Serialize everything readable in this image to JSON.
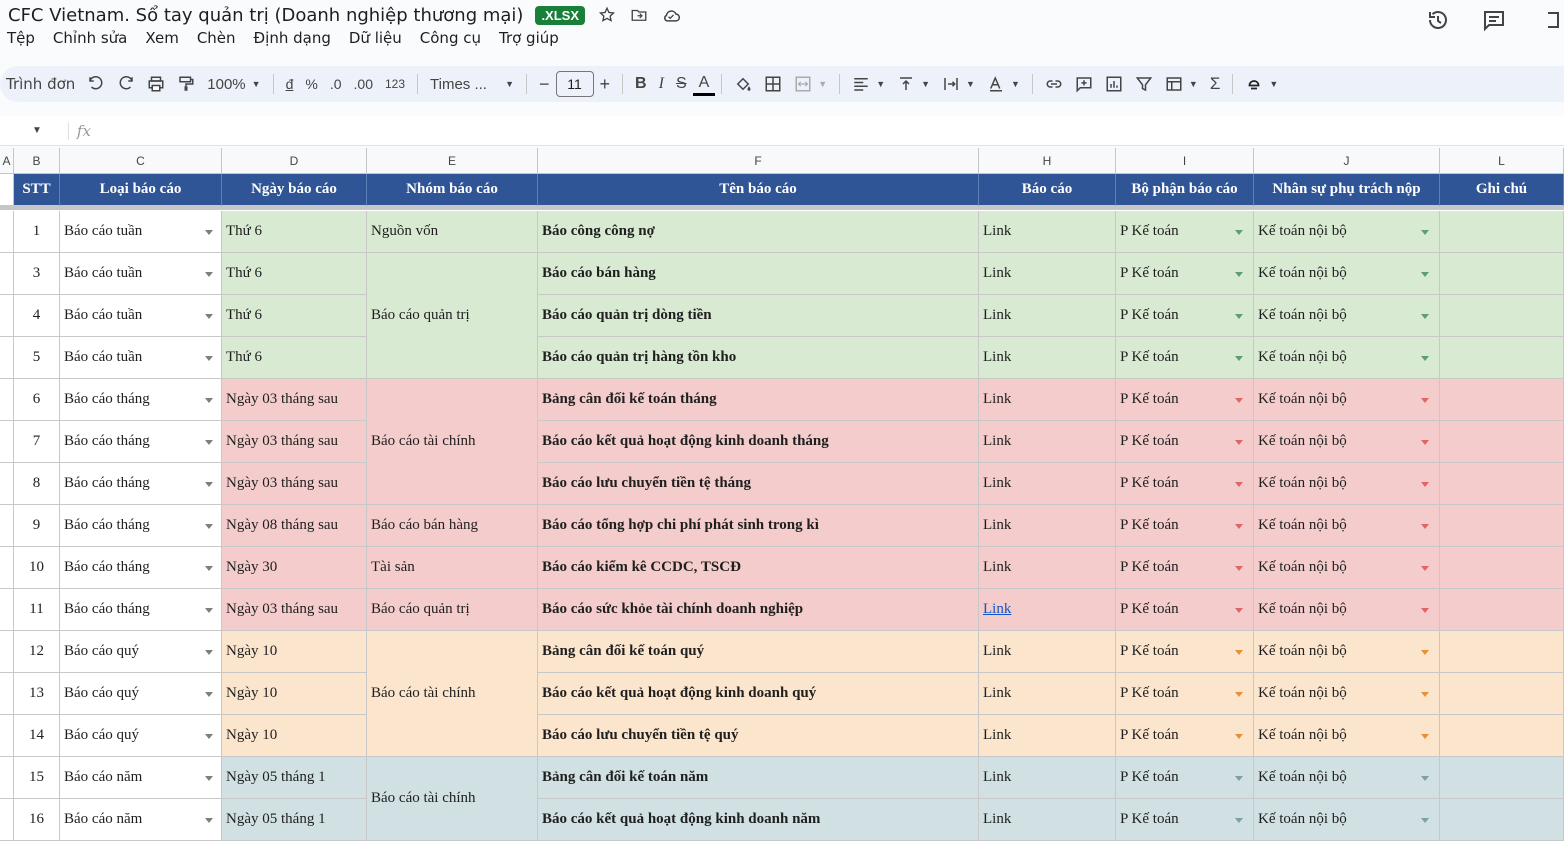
{
  "app": {
    "doc_title": "CFC Vietnam. Sổ tay quản trị (Doanh nghiệp thương mại)",
    "file_badge": ".XLSX"
  },
  "menu": [
    "Tệp",
    "Chỉnh sửa",
    "Xem",
    "Chèn",
    "Định dạng",
    "Dữ liệu",
    "Công cụ",
    "Trợ giúp"
  ],
  "toolbar": {
    "menus_label": "Trình đơn",
    "zoom": "100%",
    "currency": "đ",
    "percent": "%",
    "dec_decrease": ".0",
    "dec_increase": ".00",
    "number_format": "123",
    "font": "Times ...",
    "font_size": "11",
    "minus": "−",
    "plus": "+",
    "bold": "B",
    "italic": "I",
    "strike": "S",
    "text_color": "A",
    "sigma": "Σ"
  },
  "formula": {
    "fx": "fx"
  },
  "columns": [
    "A",
    "B",
    "C",
    "D",
    "E",
    "F",
    "H",
    "I",
    "J",
    "L"
  ],
  "headers": {
    "stt": "STT",
    "loai": "Loại báo cáo",
    "ngay": "Ngày báo cáo",
    "nhom": "Nhóm báo cáo",
    "ten": "Tên báo cáo",
    "baocao": "Báo cáo",
    "bophan": "Bộ phận báo cáo",
    "nhansu": "Nhân sự phụ trách nộp",
    "ghichu": "Ghi chú"
  },
  "rows": [
    {
      "stt": "1",
      "loai": "Báo cáo tuần",
      "ngay": "Thứ 6",
      "ten": "Báo công công nợ",
      "link": "Link",
      "bophan": "P Kế toán",
      "nhansu": "Kế toán nội bộ"
    },
    {
      "stt": "3",
      "loai": "Báo cáo tuần",
      "ngay": "Thứ 6",
      "ten": "Báo cáo bán hàng",
      "link": "Link",
      "bophan": "P Kế toán",
      "nhansu": "Kế toán nội bộ"
    },
    {
      "stt": "4",
      "loai": "Báo cáo tuần",
      "ngay": "Thứ 6",
      "ten": "Báo cáo quản trị dòng tiền",
      "link": "Link",
      "bophan": "P Kế toán",
      "nhansu": "Kế toán nội bộ"
    },
    {
      "stt": "5",
      "loai": "Báo cáo tuần",
      "ngay": "Thứ 6",
      "ten": "Báo cáo quản trị hàng tồn kho",
      "link": "Link",
      "bophan": "P Kế toán",
      "nhansu": "Kế toán nội bộ"
    },
    {
      "stt": "6",
      "loai": "Báo cáo tháng",
      "ngay": "Ngày 03 tháng sau",
      "ten": "Bảng cân đối kế toán tháng",
      "link": "Link",
      "bophan": "P Kế toán",
      "nhansu": "Kế toán nội bộ"
    },
    {
      "stt": "7",
      "loai": "Báo cáo tháng",
      "ngay": "Ngày 03 tháng sau",
      "ten": "Báo cáo kết quả hoạt động kinh doanh tháng",
      "link": "Link",
      "bophan": "P Kế toán",
      "nhansu": "Kế toán nội bộ"
    },
    {
      "stt": "8",
      "loai": "Báo cáo tháng",
      "ngay": "Ngày 03 tháng sau",
      "ten": "Báo cáo lưu chuyển tiền tệ tháng",
      "link": "Link",
      "bophan": "P Kế toán",
      "nhansu": "Kế toán nội bộ"
    },
    {
      "stt": "9",
      "loai": "Báo cáo tháng",
      "ngay": "Ngày 08 tháng sau",
      "ten": "Báo cáo tổng hợp chi phí phát sinh trong kì",
      "link": "Link",
      "bophan": "P Kế toán",
      "nhansu": "Kế toán nội bộ"
    },
    {
      "stt": "10",
      "loai": "Báo cáo tháng",
      "ngay": "Ngày 30",
      "ten": "Báo cáo kiểm kê CCDC, TSCĐ",
      "link": "Link",
      "bophan": "P Kế toán",
      "nhansu": "Kế toán nội bộ"
    },
    {
      "stt": "11",
      "loai": "Báo cáo tháng",
      "ngay": "Ngày 03 tháng sau",
      "ten": "Báo cáo sức khỏe tài chính doanh nghiệp",
      "link": "Link",
      "bophan": "P Kế toán",
      "nhansu": "Kế toán nội bộ"
    },
    {
      "stt": "12",
      "loai": "Báo cáo quý",
      "ngay": "Ngày 10",
      "ten": "Bảng cân đối kế toán quý",
      "link": "Link",
      "bophan": "P Kế toán",
      "nhansu": "Kế toán nội bộ"
    },
    {
      "stt": "13",
      "loai": "Báo cáo quý",
      "ngay": "Ngày 10",
      "ten": "Báo cáo kết quả hoạt động kinh doanh quý",
      "link": "Link",
      "bophan": "P Kế toán",
      "nhansu": "Kế toán nội bộ"
    },
    {
      "stt": "14",
      "loai": "Báo cáo quý",
      "ngay": "Ngày 10",
      "ten": "Báo cáo lưu chuyển tiền tệ quý",
      "link": "Link",
      "bophan": "P Kế toán",
      "nhansu": "Kế toán nội bộ"
    },
    {
      "stt": "15",
      "loai": "Báo cáo năm",
      "ngay": "Ngày 05 tháng 1",
      "ten": "Bảng cân đối kế toán năm",
      "link": "Link",
      "bophan": "P Kế toán",
      "nhansu": "Kế toán nội bộ"
    },
    {
      "stt": "16",
      "loai": "Báo cáo năm",
      "ngay": "Ngày 05 tháng 1",
      "ten": "Báo cáo kết quả hoạt động kinh doanh năm",
      "link": "Link",
      "bophan": "P Kế toán",
      "nhansu": "Kế toán nội bộ"
    }
  ],
  "groups": [
    {
      "label": "Nguồn vốn"
    },
    {
      "label": "Báo cáo quản trị"
    },
    {
      "label": "Báo cáo tài chính"
    },
    {
      "label": "Báo cáo bán hàng"
    },
    {
      "label": "Tài sản"
    },
    {
      "label": "Báo cáo quản trị"
    },
    {
      "label": "Báo cáo tài chính"
    },
    {
      "label": "Báo cáo tài chính"
    }
  ],
  "colors": {
    "header_bg": "#2f5597",
    "weekly": "#d9ead3",
    "monthly": "#f4cccc",
    "quarterly": "#fce5cd",
    "yearly": "#d0e0e3",
    "dd_weekly": "#5f9e6e",
    "dd_monthly": "#e06666",
    "dd_quarterly": "#e69138",
    "dd_yearly": "#7f9ea6"
  }
}
